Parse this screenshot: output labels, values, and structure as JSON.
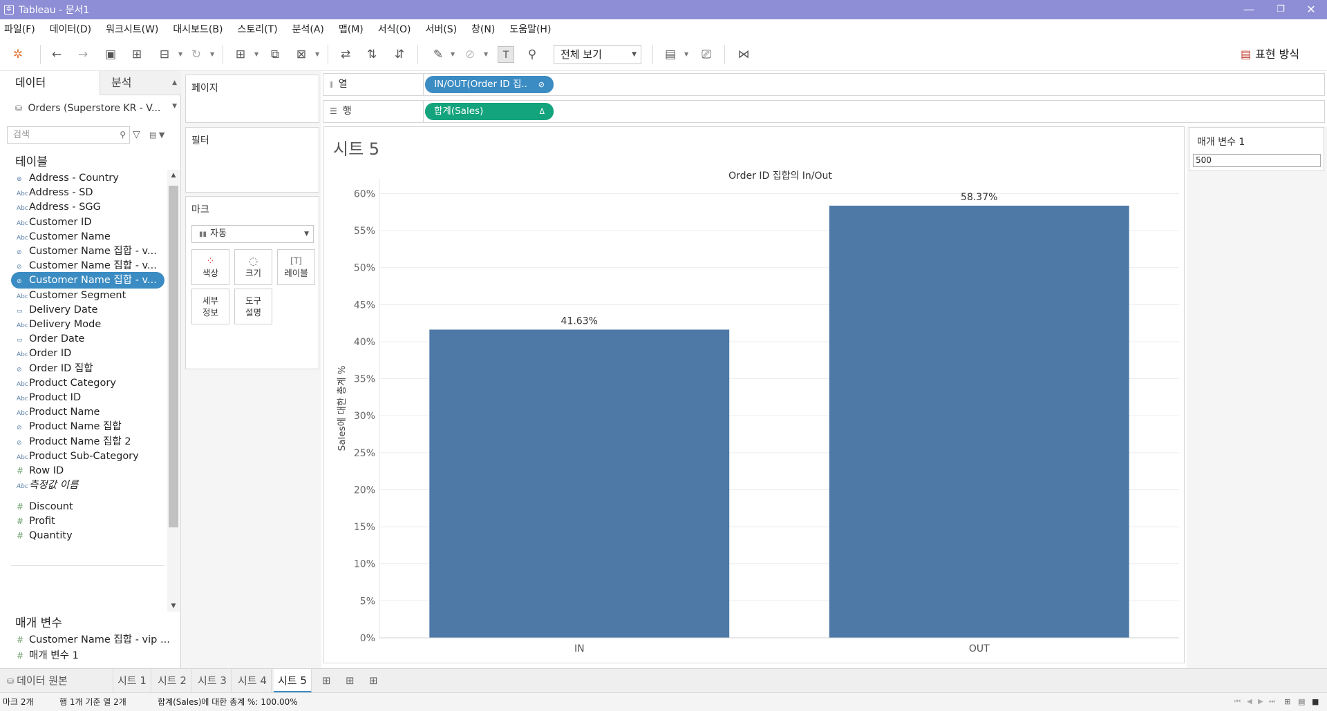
{
  "window": {
    "title": "Tableau - 문서1",
    "minimize": "—",
    "restore": "❐",
    "close": "✕"
  },
  "menu": [
    "파일(F)",
    "데이터(D)",
    "워크시트(W)",
    "대시보드(B)",
    "스토리(T)",
    "분석(A)",
    "맵(M)",
    "서식(O)",
    "서버(S)",
    "창(N)",
    "도움말(H)"
  ],
  "toolbar": {
    "view_select": "전체 보기",
    "show_me": "표현 방식"
  },
  "left": {
    "tab_data": "데이터",
    "tab_analysis": "분석",
    "datasource": "Orders (Superstore KR - V...",
    "search_placeholder": "검색",
    "tables_header": "테이블",
    "fields": [
      {
        "icon": "⊕",
        "label": "Address - Country"
      },
      {
        "icon": "Abc",
        "label": "Address - SD"
      },
      {
        "icon": "Abc",
        "label": "Address - SGG"
      },
      {
        "icon": "Abc",
        "label": "Customer ID"
      },
      {
        "icon": "Abc",
        "label": "Customer Name"
      },
      {
        "icon": "⊘",
        "label": "Customer Name 집합 - v..."
      },
      {
        "icon": "⊘",
        "label": "Customer Name 집합 - v..."
      },
      {
        "icon": "⊘",
        "label": "Customer Name 집합 - v..."
      },
      {
        "icon": "Abc",
        "label": "Customer Segment"
      },
      {
        "icon": "▭",
        "label": "Delivery Date"
      },
      {
        "icon": "Abc",
        "label": "Delivery Mode"
      },
      {
        "icon": "▭",
        "label": "Order Date"
      },
      {
        "icon": "Abc",
        "label": "Order ID"
      },
      {
        "icon": "⊘",
        "label": "Order ID 집합"
      },
      {
        "icon": "Abc",
        "label": "Product Category"
      },
      {
        "icon": "Abc",
        "label": "Product ID"
      },
      {
        "icon": "Abc",
        "label": "Product Name"
      },
      {
        "icon": "⊘",
        "label": "Product Name 집합"
      },
      {
        "icon": "⊘",
        "label": "Product Name 집합 2"
      },
      {
        "icon": "Abc",
        "label": "Product Sub-Category"
      },
      {
        "icon": "#",
        "label": "Row ID"
      },
      {
        "icon": "Abc",
        "label": "측정값 이름"
      },
      {
        "icon": "#",
        "label": "Discount"
      },
      {
        "icon": "#",
        "label": "Profit"
      },
      {
        "icon": "#",
        "label": "Quantity"
      }
    ],
    "params_header": "매개 변수",
    "params": [
      {
        "icon": "#",
        "label": "Customer Name 집합 - vip ..."
      },
      {
        "icon": "#",
        "label": "매개 변수 1"
      }
    ]
  },
  "cards": {
    "pages": "페이지",
    "filters": "필터",
    "marks": "마크",
    "mark_type": "자동",
    "color": "색상",
    "size": "크기",
    "label": "레이블",
    "detail": "세부\n정보",
    "tooltip": "도구\n설명"
  },
  "shelves": {
    "columns_label": "열",
    "columns_pill": "IN/OUT(Order ID 집..",
    "rows_label": "행",
    "rows_pill": "합계(Sales)"
  },
  "sheet": {
    "title": "시트 5"
  },
  "parameter_card": {
    "title": "매개 변수 1",
    "value": "500"
  },
  "tabs": {
    "datasource": "데이터 원본",
    "sheets": [
      "시트 1",
      "시트 2",
      "시트 3",
      "시트 4",
      "시트 5"
    ],
    "active": "시트 5"
  },
  "status": {
    "marks": "마크 2개",
    "rows_cols": "행 1개 기준 열 2개",
    "sum": "합계(Sales)에 대한 총계 %: 100.00%"
  },
  "chart_data": {
    "type": "bar",
    "title": "Order ID 집합의 In/Out",
    "xlabel": "",
    "ylabel": "Sales에 대한 총계 %",
    "categories": [
      "IN",
      "OUT"
    ],
    "values": [
      41.63,
      58.37
    ],
    "data_labels": [
      "41.63%",
      "58.37%"
    ],
    "ylim": [
      0,
      62
    ],
    "yticks": [
      0,
      5,
      10,
      15,
      20,
      25,
      30,
      35,
      40,
      45,
      50,
      55,
      60
    ],
    "ytick_labels": [
      "0%",
      "5%",
      "10%",
      "15%",
      "20%",
      "25%",
      "30%",
      "35%",
      "40%",
      "45%",
      "50%",
      "55%",
      "60%"
    ],
    "bar_color": "#4e79a7",
    "grid": true
  }
}
